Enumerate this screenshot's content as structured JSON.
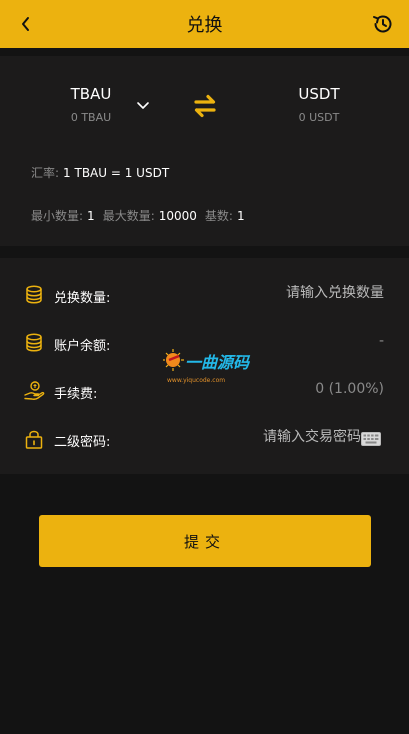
{
  "header": {
    "title": "兑换"
  },
  "exchange": {
    "from": {
      "symbol": "TBAU",
      "balance": "0 TBAU"
    },
    "to": {
      "symbol": "USDT",
      "balance": "0 USDT"
    },
    "rate_label": "汇率:",
    "rate_value": "1 TBAU = 1 USDT",
    "min_label": "最小数量:",
    "min_value": "1",
    "max_label": "最大数量:",
    "max_value": "10000",
    "base_label": "基数:",
    "base_value": "1"
  },
  "form": {
    "amount_label": "兑换数量:",
    "amount_placeholder": "请输入兑换数量",
    "balance_label": "账户余额:",
    "balance_value": "-",
    "fee_label": "手续费:",
    "fee_value": "0 (1.00%)",
    "password_label": "二级密码:",
    "password_placeholder": "请输入交易密码"
  },
  "watermark": {
    "brand": "一曲源码",
    "url": "www.yiqucode.com"
  },
  "submit_label": "提交",
  "colors": {
    "accent": "#ecb20f",
    "background": "#131313",
    "panel": "#1c1b1b",
    "muted": "#8a8a8a"
  },
  "icons": [
    "back-arrow-icon",
    "history-icon",
    "chevron-down-icon",
    "swap-icon",
    "coins-icon",
    "wallet-coins-icon",
    "fee-hand-icon",
    "lock-icon",
    "keyboard-icon"
  ]
}
